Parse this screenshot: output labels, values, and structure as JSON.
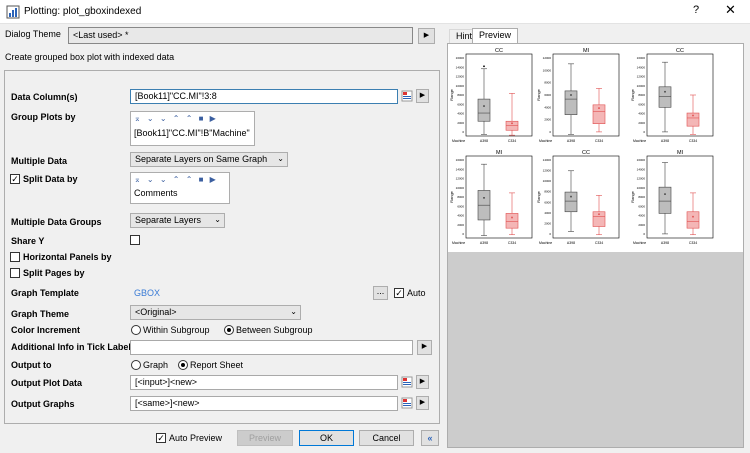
{
  "window": {
    "title": "Plotting: plot_gboxindexed",
    "help": "?",
    "close": "✕"
  },
  "dialog_theme": {
    "label": "Dialog Theme",
    "value": "<Last used> *"
  },
  "description": "Create grouped box plot with indexed data",
  "form": {
    "data_columns": {
      "label": "Data Column(s)",
      "value": "[Book11]\"CC.MI\"!3:8"
    },
    "group_plots_by": {
      "label": "Group Plots by",
      "value": "[Book11]\"CC.MI\"!B\"Machine\""
    },
    "multiple_data": {
      "label": "Multiple Data",
      "value": "Separate Layers on Same Graph"
    },
    "split_data_by": {
      "label": "Split Data by",
      "value": "Comments",
      "checked": true
    },
    "multiple_data_groups": {
      "label": "Multiple Data Groups",
      "value": "Separate Layers"
    },
    "share_y": {
      "label": "Share Y",
      "checked": false
    },
    "horizontal_panels_by": {
      "label": "Horizontal Panels by",
      "checked": false
    },
    "split_pages_by": {
      "label": "Split Pages by",
      "checked": false
    },
    "graph_template": {
      "label": "Graph Template",
      "value": "GBOX",
      "browse": "...",
      "auto_label": "Auto",
      "auto_checked": true
    },
    "graph_theme": {
      "label": "Graph Theme",
      "value": "<Original>"
    },
    "color_increment": {
      "label": "Color Increment",
      "options": [
        "Within Subgroup",
        "Between Subgroup"
      ],
      "selected": "Between Subgroup"
    },
    "additional_info": {
      "label": "Additional Info in Tick Labels",
      "value": ""
    },
    "output_to": {
      "label": "Output to",
      "options": [
        "Graph",
        "Report Sheet"
      ],
      "selected": "Report Sheet"
    },
    "output_plot_data": {
      "label": "Output Plot Data",
      "value": "[<input>]<new>"
    },
    "output_graphs": {
      "label": "Output Graphs",
      "value": "[<same>]<new>"
    }
  },
  "toolbar_icons": "⌅ ⌄ ⌄ ⌃ ⌃ ■ ▶",
  "buttons": {
    "auto_preview": "Auto Preview",
    "auto_preview_checked": true,
    "preview": "Preview",
    "ok": "OK",
    "cancel": "Cancel",
    "collapse": "«"
  },
  "tabs": [
    "Hint",
    "Preview"
  ],
  "active_tab": "Preview",
  "preview_plots": [
    {
      "title": "CC",
      "ylabel": "Range",
      "xlabels": [
        "A398",
        "C334"
      ],
      "xtitle": "Machine",
      "yticks": [
        "16000",
        "14000",
        "12000",
        "10000",
        "8000",
        "6000",
        "4000",
        "2000",
        "0"
      ]
    },
    {
      "title": "MI",
      "ylabel": "Range",
      "xlabels": [
        "A398",
        "C334"
      ],
      "xtitle": "Machine",
      "yticks": [
        "12000",
        "10000",
        "8000",
        "6000",
        "4000",
        "2000",
        "0"
      ]
    },
    {
      "title": "CC",
      "ylabel": "Range",
      "xlabels": [
        "A398",
        "C334"
      ],
      "xtitle": "Machine",
      "yticks": [
        "16000",
        "14000",
        "12000",
        "10000",
        "8000",
        "6000",
        "4000",
        "2000",
        "0"
      ]
    },
    {
      "title": "MI",
      "ylabel": "Range",
      "xlabels": [
        "A398",
        "C334"
      ],
      "xtitle": "Machine",
      "yticks": [
        "16000",
        "14000",
        "12000",
        "10000",
        "8000",
        "6000",
        "4000",
        "2000",
        "0"
      ]
    },
    {
      "title": "CC",
      "ylabel": "Range",
      "xlabels": [
        "A398",
        "C334"
      ],
      "xtitle": "Machine",
      "yticks": [
        "14000",
        "12000",
        "10000",
        "8000",
        "6000",
        "4000",
        "2000",
        "0"
      ]
    },
    {
      "title": "MI",
      "ylabel": "Range",
      "xlabels": [
        "A398",
        "C334"
      ],
      "xtitle": "Machine",
      "yticks": [
        "16000",
        "14000",
        "12000",
        "10000",
        "8000",
        "6000",
        "4000",
        "2000",
        "0"
      ]
    }
  ],
  "colors": {
    "gray_box": "#bdbdbd",
    "red_box": "#f4b6b6",
    "red_line": "#e05050",
    "preview_bg": "#cccccc"
  }
}
